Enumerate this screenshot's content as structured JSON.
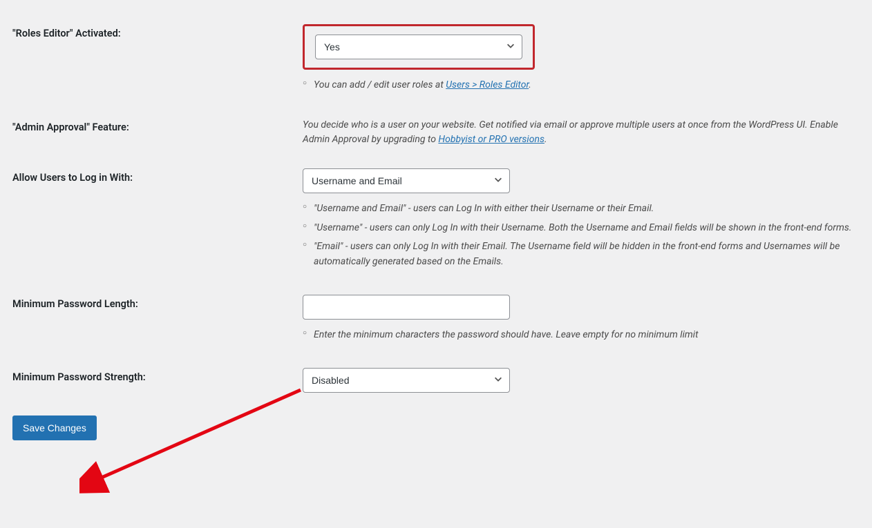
{
  "fields": {
    "roles_editor": {
      "label": "\"Roles Editor\" Activated:",
      "value": "Yes",
      "help_prefix": "You can add / edit user roles at ",
      "help_link": "Users > Roles Editor",
      "help_suffix": "."
    },
    "admin_approval": {
      "label": "\"Admin Approval\" Feature:",
      "desc_prefix": "You decide who is a user on your website. Get notified via email or approve multiple users at once from the WordPress UI. Enable Admin Approval by upgrading to ",
      "desc_link": "Hobbyist or PRO versions",
      "desc_suffix": "."
    },
    "login_with": {
      "label": "Allow Users to Log in With:",
      "value": "Username and Email",
      "help1": "\"Username and Email\" - users can Log In with either their Username or their Email.",
      "help2": "\"Username\" - users can only Log In with their Username. Both the Username and Email fields will be shown in the front-end forms.",
      "help3": "\"Email\" - users can only Log In with their Email. The Username field will be hidden in the front-end forms and Usernames will be automatically generated based on the Emails."
    },
    "min_pwd_length": {
      "label": "Minimum Password Length:",
      "value": "",
      "help": "Enter the minimum characters the password should have. Leave empty for no minimum limit"
    },
    "min_pwd_strength": {
      "label": "Minimum Password Strength:",
      "value": "Disabled"
    }
  },
  "save_label": "Save Changes"
}
